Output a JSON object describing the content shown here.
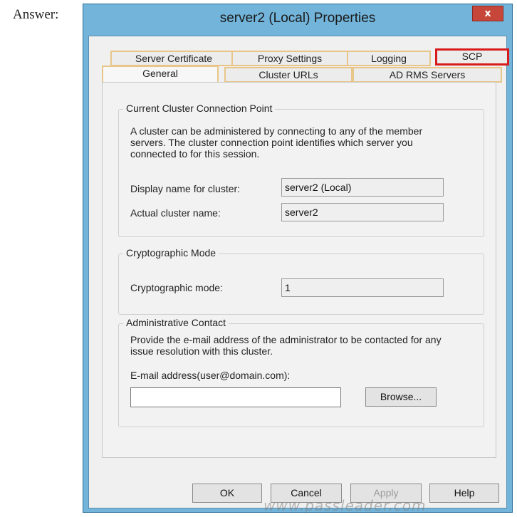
{
  "page": {
    "label": "Answer:"
  },
  "window": {
    "title": "server2 (Local) Properties",
    "close_glyph": "x"
  },
  "tabs_row1": [
    "Server Certificate",
    "Proxy Settings",
    "Logging",
    "SCP"
  ],
  "tabs_row2": [
    "General",
    "Cluster URLs",
    "AD RMS Servers"
  ],
  "highlight": {
    "tab": "SCP",
    "color": "#d81b1b"
  },
  "general": {
    "ccp": {
      "title": "Current Cluster Connection Point",
      "desc_lines": [
        "A cluster can be administered by connecting to any of the member",
        "servers. The cluster connection point identifies which server you",
        "connected to for this session."
      ],
      "display_label": "Display name for cluster:",
      "display_value": "server2 (Local)",
      "actual_label": "Actual cluster name:",
      "actual_value": "server2"
    },
    "crypto": {
      "title": "Cryptographic Mode",
      "mode_label": "Cryptographic mode:",
      "mode_value": "1"
    },
    "admin": {
      "title": "Administrative Contact",
      "desc_lines": [
        "Provide the e-mail address of the administrator to be contacted for any",
        "issue resolution with this cluster."
      ],
      "email_label": "E-mail address(user@domain.com):",
      "email_value": "",
      "browse_label": "Browse..."
    }
  },
  "buttons": {
    "ok": "OK",
    "cancel": "Cancel",
    "apply": "Apply",
    "help": "Help"
  },
  "watermark": "www.passleader.com"
}
